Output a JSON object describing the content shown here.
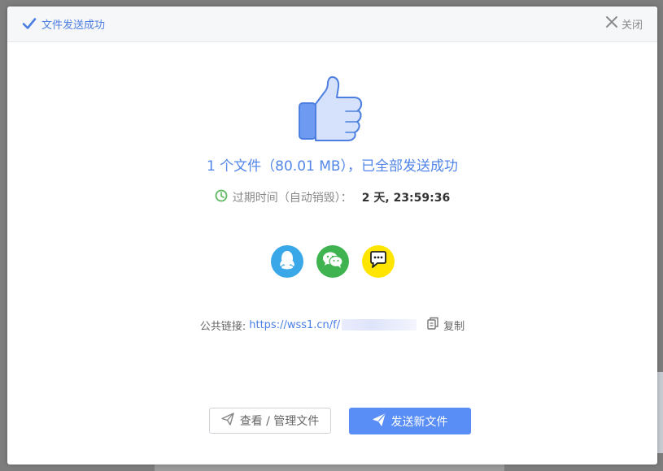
{
  "header": {
    "title": "文件发送成功",
    "close_label": "关闭"
  },
  "result": {
    "summary": "1 个文件（80.01 MB），已全部发送成功",
    "expiry_label": "过期时间（自动销毁）：",
    "countdown": "2 天, 23:59:36"
  },
  "share": {
    "targets": [
      "qq",
      "wechat",
      "messenger"
    ],
    "colors": {
      "qq": "#3aa8e8",
      "wechat": "#3fb34f",
      "messenger": "#ffe500"
    }
  },
  "link": {
    "label": "公共链接:",
    "url": "https://wss1.cn/f/",
    "copy_label": "复制"
  },
  "actions": {
    "manage_label": "查看 / 管理文件",
    "send_label": "发送新文件"
  },
  "colors": {
    "accent": "#5a8ef7",
    "success_clock": "#5cb85c"
  }
}
